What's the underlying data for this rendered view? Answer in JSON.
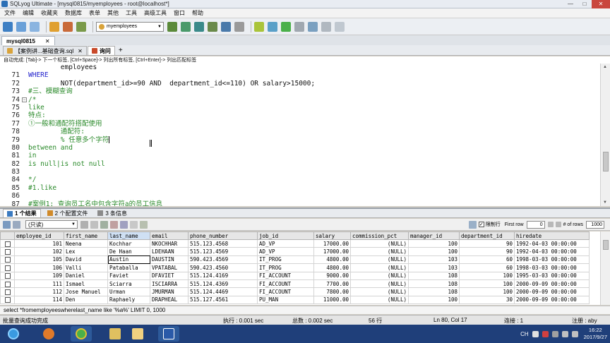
{
  "window": {
    "title": "SQLyog Ultimate - [mysql0815/myemployees - root@localhost*]",
    "min": "—",
    "max": "□",
    "close": "✕"
  },
  "menu": [
    "文件",
    "编辑",
    "收藏夹",
    "数据库",
    "表单",
    "其他",
    "工具",
    "高级工具",
    "窗口",
    "帮助"
  ],
  "toolbar": {
    "db_selected": "myemployees"
  },
  "connection": {
    "tab_label": "mysql0815",
    "close": "✕"
  },
  "query_tabs": [
    {
      "label": "【案例讲...基础查询.sql",
      "active": false
    },
    {
      "label": "询问",
      "active": true
    }
  ],
  "query_tab_close": "✕",
  "query_tab_add": "+",
  "hint": "自动完成: [Tab]-> 下一个标签, [Ctrl+Space]-> 列出所有标签, [Ctrl+Enter]-> 列出匹配标签",
  "editor": {
    "lines": [
      {
        "n": "",
        "text": "        employees",
        "cls": "tx"
      },
      {
        "n": "71",
        "text": "WHERE",
        "cls": "kw"
      },
      {
        "n": "72",
        "text": "        NOT(department_id>=90 AND  department_id<=110) OR salary>15000;",
        "cls": "tx"
      },
      {
        "n": "73",
        "text": "#三、模糊查询",
        "cls": "cm"
      },
      {
        "n": "74",
        "text": "/*",
        "cls": "cm"
      },
      {
        "n": "75",
        "text": "like",
        "cls": "cm"
      },
      {
        "n": "76",
        "text": "特点:",
        "cls": "cm"
      },
      {
        "n": "77",
        "text": "①一般和通配符搭配使用",
        "cls": "cm"
      },
      {
        "n": "78",
        "text": "        通配符:",
        "cls": "cm"
      },
      {
        "n": "79",
        "text": "        % 任意多个字符",
        "cls": "cm"
      },
      {
        "n": "80",
        "text": "between and",
        "cls": "cm"
      },
      {
        "n": "81",
        "text": "in",
        "cls": "cm"
      },
      {
        "n": "82",
        "text": "is null|is not null",
        "cls": "cm"
      },
      {
        "n": "83",
        "text": "",
        "cls": "cm"
      },
      {
        "n": "84",
        "text": "*/",
        "cls": "cm"
      },
      {
        "n": "85",
        "text": "#1.like",
        "cls": "cm"
      },
      {
        "n": "86",
        "text": "",
        "cls": "cm"
      },
      {
        "n": "87",
        "text": "#案例1: 查询员工名中包含字符a的员工信息",
        "cls": "cm"
      }
    ]
  },
  "result_tabs": [
    {
      "label": "1 个结果",
      "active": true
    },
    {
      "label": "2 个配置文件",
      "active": false
    },
    {
      "label": "3 条信息",
      "active": false
    }
  ],
  "grid_toolbar": {
    "mode": "(只读)",
    "limit_label": "限制行",
    "first_row_label": "First row",
    "first_row": "0",
    "rows_label": "# of rows",
    "rows": "1000"
  },
  "grid": {
    "columns": [
      "employee_id",
      "first_name",
      "last_name",
      "email",
      "phone_number",
      "job_id",
      "salary",
      "commission_pct",
      "manager_id",
      "department_id",
      "hiredate"
    ],
    "rows": [
      [
        "101",
        "Neena",
        "Kochhar",
        "NKOCHHAR",
        "515.123.4568",
        "AD_VP",
        "17000.00",
        "(NULL)",
        "100",
        "90",
        "1992-04-03 00:00:00"
      ],
      [
        "102",
        "Lex",
        "De Haan",
        "LDEHAAN",
        "515.123.4569",
        "AD_VP",
        "17000.00",
        "(NULL)",
        "100",
        "90",
        "1992-04-03 00:00:00"
      ],
      [
        "105",
        "David",
        "Austin",
        "DAUSTIN",
        "590.423.4569",
        "IT_PROG",
        "4800.00",
        "(NULL)",
        "103",
        "60",
        "1998-03-03 00:00:00"
      ],
      [
        "106",
        "Valli",
        "Pataballa",
        "VPATABAL",
        "590.423.4560",
        "IT_PROG",
        "4800.00",
        "(NULL)",
        "103",
        "60",
        "1998-03-03 00:00:00"
      ],
      [
        "109",
        "Daniel",
        "Faviet",
        "DFAVIET",
        "515.124.4169",
        "FI_ACCOUNT",
        "9000.00",
        "(NULL)",
        "108",
        "100",
        "1995-03-03 00:00:00"
      ],
      [
        "111",
        "Ismael",
        "Sciarra",
        "ISCIARRA",
        "515.124.4369",
        "FI_ACCOUNT",
        "7700.00",
        "(NULL)",
        "108",
        "100",
        "2000-09-09 00:00:00"
      ],
      [
        "112",
        "Jose Manuel",
        "Urman",
        "JMURMAN",
        "515.124.4469",
        "FI_ACCOUNT",
        "7800.00",
        "(NULL)",
        "108",
        "100",
        "2000-09-09 00:00:00"
      ],
      [
        "114",
        "Den",
        "Raphaely",
        "DRAPHEAL",
        "515.127.4561",
        "PU_MAN",
        "11000.00",
        "(NULL)",
        "100",
        "30",
        "2000-09-09 00:00:00"
      ]
    ]
  },
  "sql_bar": "select *fromemployeeswherelast_name like '%a%' LIMIT 0, 1000",
  "status": {
    "left": "批量查询成功完成",
    "exec": "执行 : 0.001 sec",
    "total": "总数 : 0.002 sec",
    "rows": "56 行",
    "pos": "Ln 80, Col 17",
    "conn": "连接 : 1",
    "reg": "注册 : aby"
  },
  "tray": {
    "lang": "CH",
    "time": "16:22",
    "date": "2017/9/27"
  }
}
